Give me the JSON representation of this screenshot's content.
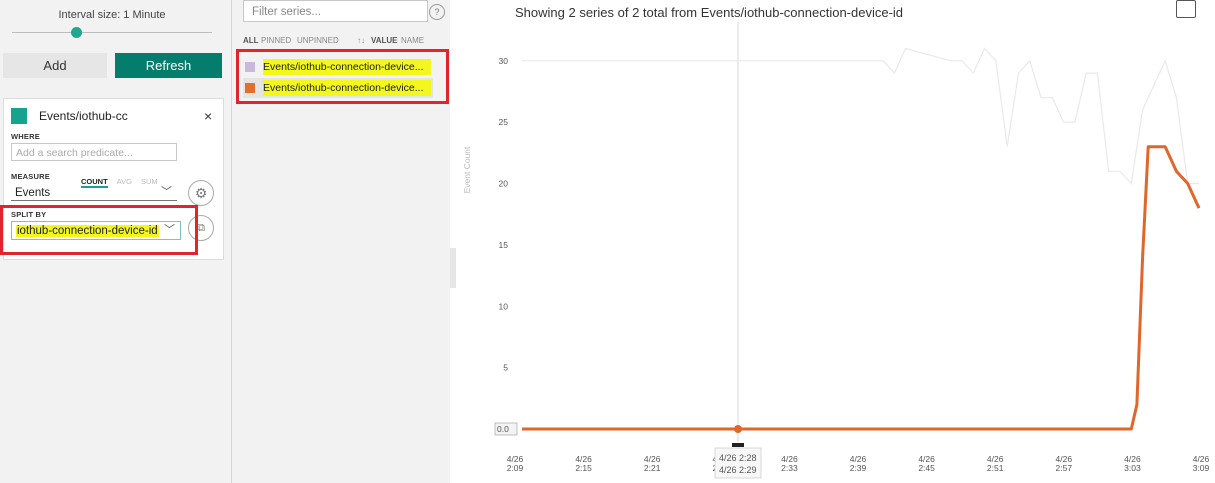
{
  "left": {
    "interval_label": "Interval size: 1 Minute",
    "interval_value": 0.32,
    "add_label": "Add",
    "refresh_label": "Refresh",
    "card": {
      "title": "Events/iothub-cc",
      "close": "×",
      "where_label": "WHERE",
      "predicate_placeholder": "Add a search predicate...",
      "measure_label": "MEASURE",
      "measure_tabs": [
        "COUNT",
        "AVG",
        "SUM"
      ],
      "measure_value": "Events",
      "split_label": "SPLIT BY",
      "split_value": "iothub-connection-device-id"
    }
  },
  "mid": {
    "filter_placeholder": "Filter series...",
    "help": "?",
    "segments": [
      "ALL",
      "PINNED",
      "UNPINNED"
    ],
    "sort_icon": "↑↓",
    "sort_options": [
      "VALUE",
      "NAME"
    ],
    "series": [
      {
        "name": "Events/iothub-connection-device...",
        "color": "#c9b8dc"
      },
      {
        "name": "Events/iothub-connection-device...",
        "color": "#e0702a"
      }
    ]
  },
  "chart": {
    "title": "Showing 2 series of 2 total from Events/iothub-connection-device-id",
    "ylabel": "Event Count",
    "zero_label": "0.0",
    "tooltip": [
      "4/26 2:28",
      "4/26 2:29"
    ],
    "colors": {
      "faint": "#e9e9e9",
      "main": "#e0662a",
      "grid": "#ececec"
    }
  },
  "chart_data": {
    "type": "line",
    "ylabel": "Event Count",
    "ylim": [
      0,
      33
    ],
    "yticks": [
      5,
      10,
      15,
      20,
      25,
      30
    ],
    "xticks": [
      [
        "4/26",
        "2:09"
      ],
      [
        "4/26",
        "2:15"
      ],
      [
        "4/26",
        "2:21"
      ],
      [
        "4/26",
        "2:27"
      ],
      [
        "4/26",
        "2:33"
      ],
      [
        "4/26",
        "2:39"
      ],
      [
        "4/26",
        "2:45"
      ],
      [
        "4/26",
        "2:51"
      ],
      [
        "4/26",
        "2:57"
      ],
      [
        "4/26",
        "3:03"
      ],
      [
        "4/26",
        "3:09"
      ]
    ],
    "xlim": [
      0,
      60
    ],
    "series": [
      {
        "x": [
          0,
          31,
          31.5,
          32,
          33,
          34,
          38,
          39,
          40,
          41,
          42,
          43,
          44,
          45,
          46,
          47,
          48,
          49,
          50,
          51,
          52,
          53,
          54,
          55,
          56,
          57,
          58,
          59,
          60
        ],
        "y": [
          30,
          30,
          30,
          30,
          29,
          31,
          30,
          30,
          29,
          31,
          30,
          23,
          29,
          30,
          27,
          27,
          25,
          25,
          29,
          29,
          21,
          21,
          20,
          26,
          28,
          30,
          27,
          20,
          20
        ],
        "color": "#e9e9e9"
      },
      {
        "x": [
          0,
          54,
          54.5,
          55,
          55.5,
          56,
          57,
          57.5,
          58,
          59,
          60
        ],
        "y": [
          0,
          0,
          2,
          14,
          23,
          23,
          23,
          22,
          21,
          20,
          18
        ],
        "color": "#e0662a"
      }
    ]
  }
}
